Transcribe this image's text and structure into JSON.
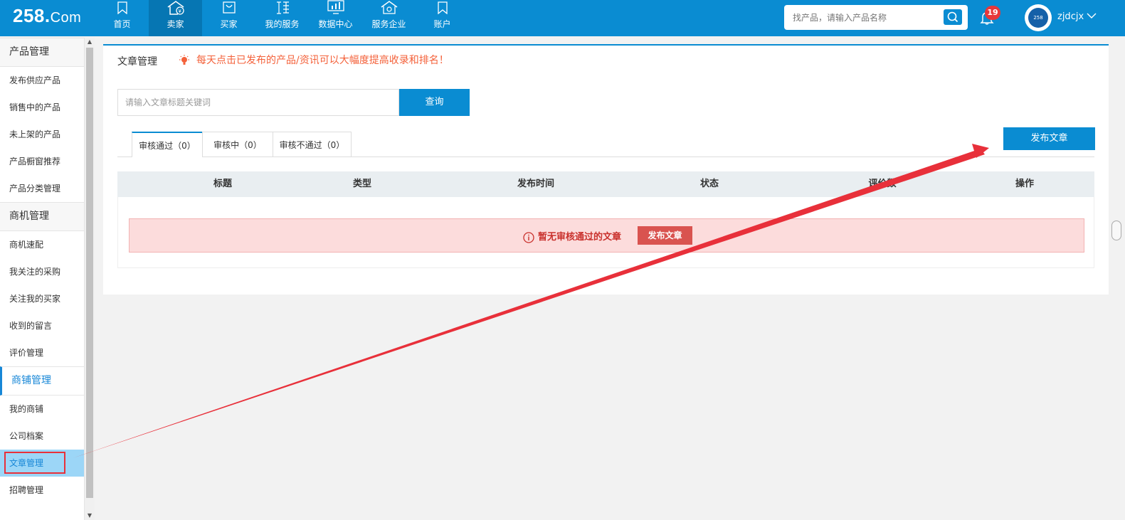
{
  "header": {
    "logo_main": "258.",
    "logo_suffix": "Com",
    "nav": [
      {
        "label": "首页",
        "icon": "bookmark-icon"
      },
      {
        "label": "卖家",
        "icon": "shop-yen-icon",
        "active": true
      },
      {
        "label": "买家",
        "icon": "bag-icon"
      },
      {
        "label": "我的服务",
        "icon": "service-icon"
      },
      {
        "label": "数据中心",
        "icon": "monitor-chart-icon"
      },
      {
        "label": "服务企业",
        "icon": "enterprise-icon"
      },
      {
        "label": "账户",
        "icon": "bookmark-icon"
      }
    ],
    "search_placeholder": "找产品，请输入产品名称",
    "notification_count": "19",
    "avatar_text": "258",
    "username": "zjdcjx"
  },
  "sidebar": {
    "groups": [
      {
        "title": "产品管理",
        "items": [
          "发布供应产品",
          "销售中的产品",
          "未上架的产品",
          "产品橱窗推荐",
          "产品分类管理"
        ]
      },
      {
        "title": "商机管理",
        "items": [
          "商机速配",
          "我关注的采购",
          "关注我的买家",
          "收到的留言",
          "评价管理"
        ]
      },
      {
        "title": "商铺管理",
        "items": [
          "我的商铺",
          "公司档案",
          "文章管理",
          "招聘管理"
        ]
      }
    ],
    "active_item": "文章管理"
  },
  "main": {
    "title": "文章管理",
    "tip": "每天点击已发布的产品/资讯可以大幅度提高收录和排名！",
    "search_placeholder": "请输入文章标题关键词",
    "search_button": "查询",
    "tabs": [
      "审核通过（0）",
      "审核中（0）",
      "审核不通过（0）"
    ],
    "publish_button": "发布文章",
    "columns": [
      "标题",
      "类型",
      "发布时间",
      "状态",
      "评价数",
      "操作"
    ],
    "empty_text": "暂无审核通过的文章",
    "empty_button": "发布文章"
  },
  "colors": {
    "brand": "#0a8cd2",
    "alert_bg": "#fcdcdc",
    "danger": "#d9534f",
    "annotation": "#e8303a"
  }
}
